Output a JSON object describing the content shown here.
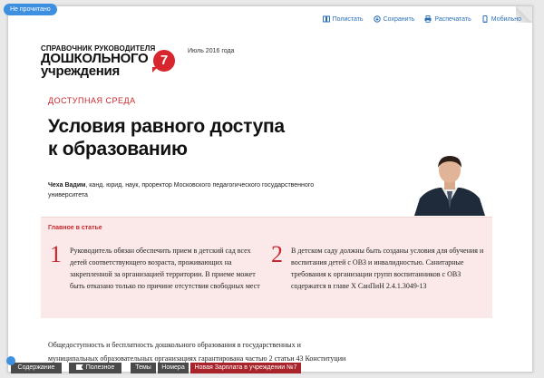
{
  "status": {
    "unread_badge": "Не прочитано"
  },
  "toolbar": {
    "items": [
      {
        "label": "Полистать",
        "icon": "book-icon"
      },
      {
        "label": "Сохранить",
        "icon": "save-icon"
      },
      {
        "label": "Распечатать",
        "icon": "print-icon"
      },
      {
        "label": "Мобильно",
        "icon": "mobile-icon"
      }
    ]
  },
  "logo": {
    "line1": "СПРАВОЧНИК РУКОВОДИТЕЛЯ",
    "line2": "ДОШКОЛЬНОГО",
    "line3": "учреждения",
    "issue_number": "7"
  },
  "issue_date": "Июль 2016 года",
  "article": {
    "section": "ДОСТУПНАЯ СРЕДА",
    "title_line1": "Условия равного доступа",
    "title_line2": "к образованию",
    "author_name": "Чеха Вадим",
    "author_desc": ", канд. юрид. наук, проректор Московского педагогического государственного университета"
  },
  "highlights": {
    "heading": "Главное в статье",
    "items": [
      {
        "number": "1",
        "text": "Руководитель обязан обеспечить прием в детский сад всех детей соответствующего возраста, проживающих на закрепленной за организацией территории. В приеме может быть отказано только по причине отсутствия свободных мест"
      },
      {
        "number": "2",
        "text": "В детском саду должны быть созданы условия для обучения и воспитания детей с ОВЗ и инвалидностью. Санитарные требования к организации групп воспитанников с ОВЗ содержатся в главе X СанПиН 2.4.1.3049-13"
      }
    ]
  },
  "body": {
    "paragraph": "Общедоступность и бесплатность дошкольного образования в государственных и муниципальных образовательных организациях гарантирована частью 2 статьи 43 Конституции"
  },
  "bottom_nav": {
    "contents": "Содержание",
    "useful": "Полезное",
    "topics": "Темы",
    "issues": "Номера",
    "new_issue": "Новая Зарплата в учреждении №7"
  },
  "colors": {
    "accent_red": "#c7282e",
    "link_blue": "#2a6fb6",
    "badge_blue": "#3d8fe0",
    "highlight_bg": "#fbe9e9"
  }
}
